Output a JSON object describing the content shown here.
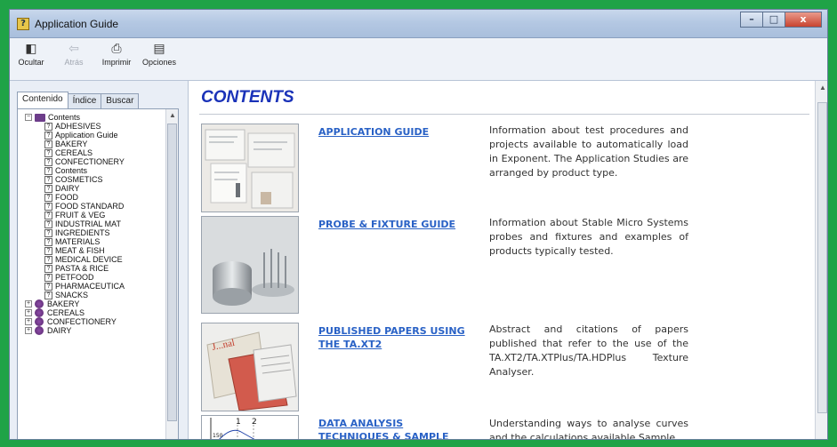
{
  "window": {
    "title": "Application Guide",
    "app_icon": "help-book-icon",
    "controls": {
      "minimize": "–",
      "maximize": "□",
      "close": "x"
    }
  },
  "toolbar": {
    "items": [
      {
        "label": "Ocultar",
        "icon": "hide-pane-icon",
        "glyph": "◧",
        "enabled": true
      },
      {
        "label": "Atrás",
        "icon": "back-arrow-icon",
        "glyph": "⇦",
        "enabled": false
      },
      {
        "label": "Imprimir",
        "icon": "printer-icon",
        "glyph": "⎙",
        "enabled": true
      },
      {
        "label": "Opciones",
        "icon": "options-icon",
        "glyph": "▤",
        "enabled": true
      }
    ]
  },
  "nav_tabs": [
    "Contenido",
    "Índice",
    "Buscar"
  ],
  "tree": {
    "root": "Contents",
    "children": [
      "ADHESIVES",
      "Application Guide",
      "BAKERY",
      "CEREALS",
      "CONFECTIONERY",
      "Contents",
      "COSMETICS",
      "DAIRY",
      "FOOD",
      "FOOD STANDARD",
      "FRUIT & VEG",
      "INDUSTRIAL MAT",
      "INGREDIENTS",
      "MATERIALS",
      "MEAT & FISH",
      "MEDICAL DEVICE",
      "PASTA & RICE",
      "PETFOOD",
      "PHARMACEUTICA",
      "SNACKS"
    ],
    "books": [
      "BAKERY",
      "CEREALS",
      "CONFECTIONERY",
      "DAIRY"
    ]
  },
  "content": {
    "title": "CONTENTS",
    "entries": [
      {
        "link": "APPLICATION GUIDE",
        "description": "Information about test procedures and projects available to automatically load in Exponent. The Application Studies are arranged by product type.",
        "thumb": "document-pages-image"
      },
      {
        "link": "PROBE & FIXTURE GUIDE",
        "description": "Information about Stable Micro Systems probes and fixtures and examples of products typically tested.",
        "thumb": "probes-photo-image"
      },
      {
        "link": "PUBLISHED PAPERS USING THE TA.XT2",
        "description": "Abstract and citations of papers published that refer to the use of the TA.XT2/TA.XTPlus/TA.HDPlus Texture Analyser.",
        "thumb": "journals-photo-image"
      },
      {
        "link": "DATA ANALYSIS TECHNIQUES & SAMPLE MACROS & PROJECTS",
        "description": "Understanding ways to analyse curves and the calculations available.Sample",
        "thumb": "graph-plot-image",
        "thumb_labels": [
          "1",
          "2",
          "150"
        ]
      }
    ]
  },
  "colors": {
    "outer_frame": "#1fa347",
    "heading": "#1a32b8",
    "link": "#2a62c6",
    "book_icon": "#6d3d8a"
  }
}
